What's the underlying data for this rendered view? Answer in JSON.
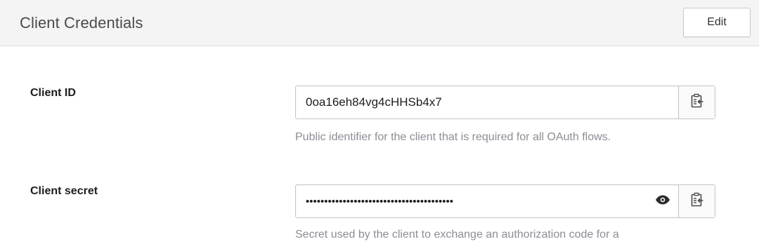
{
  "header": {
    "title": "Client Credentials",
    "edit_label": "Edit"
  },
  "client_id": {
    "label": "Client ID",
    "value": "0oa16eh84vg4cHHSb4x7",
    "help": "Public identifier for the client that is required for all OAuth flows.",
    "copy_icon": "clipboard-copy-icon"
  },
  "client_secret": {
    "label": "Client secret",
    "value": "••••••••••••••••••••••••••••••••••••••••",
    "help": "Secret used by the client to exchange an authorization code for a",
    "reveal_icon": "eye-icon",
    "copy_icon": "clipboard-copy-icon"
  }
}
